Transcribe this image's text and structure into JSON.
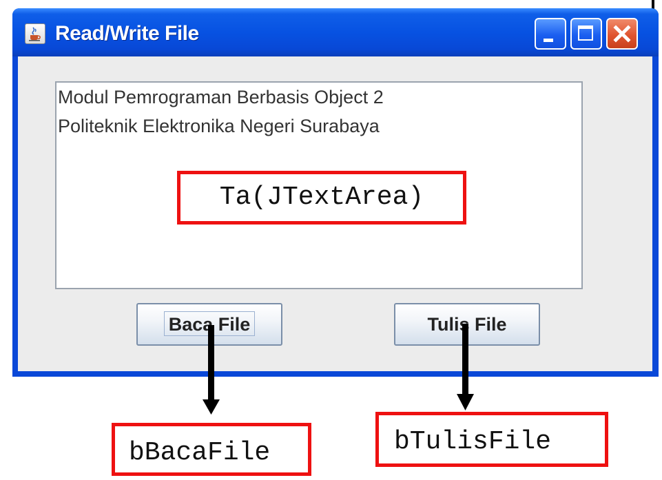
{
  "window": {
    "title": "Read/Write File",
    "icon": "java-cup-icon",
    "controls": [
      "minimize-icon",
      "maximize-icon",
      "close-icon"
    ]
  },
  "textarea": {
    "lines": [
      "Modul Pemrograman Berbasis Object 2",
      "Politeknik Elektronika Negeri Surabaya"
    ]
  },
  "buttons": {
    "baca_label": "Baca File",
    "tulis_label": "Tulis File"
  },
  "annotations": {
    "textarea_label": "Ta(JTextArea)",
    "baca_label": "bBacaFile",
    "tulis_label": "bTulisFile",
    "color": "#ee1111"
  },
  "colors": {
    "titlebar": "#0752e2",
    "client": "#ececec"
  }
}
